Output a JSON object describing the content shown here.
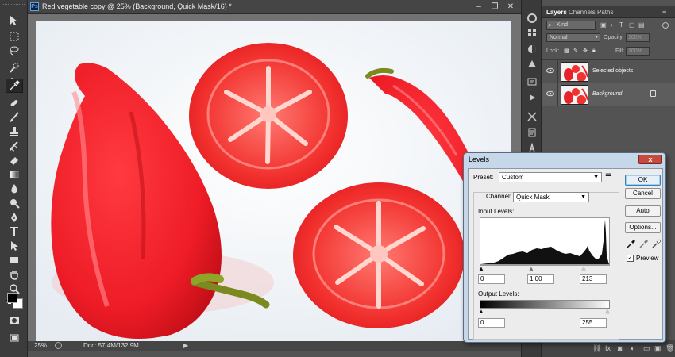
{
  "document": {
    "ps_badge": "Ps",
    "title": "Red vegetable copy @ 25% (Background, Quick Mask/16) *",
    "minimize": "–",
    "restore": "❐",
    "close": "✕",
    "status_zoom": "25%",
    "status_doc": "Doc: 57.4M/132.9M",
    "status_arrow": "▶"
  },
  "tools": [
    "move-tool",
    "marquee-tool",
    "lasso-tool",
    "quick-selection-tool",
    "crop-tool",
    "eyedropper-tool",
    "healing-brush-tool",
    "brush-tool",
    "clone-stamp-tool",
    "history-brush-tool",
    "eraser-tool",
    "gradient-tool",
    "blur-tool",
    "dodge-tool",
    "pen-tool",
    "type-tool",
    "path-selection-tool",
    "shape-tool",
    "hand-tool",
    "zoom-tool",
    "default-colors",
    "foreground-color",
    "background-color",
    "quick-mask-mode",
    "screen-mode"
  ],
  "layers_panel": {
    "tabs": [
      "Layers",
      "Channels",
      "Paths"
    ],
    "filter_kind": "Kind",
    "blend_mode": "Normal",
    "opacity_label": "Opacity:",
    "opacity_value": "100%",
    "lock_label": "Lock:",
    "fill_label": "Fill:",
    "fill_value": "100%",
    "layers": [
      {
        "name": "Selected objects",
        "selected": false
      },
      {
        "name": "Background",
        "selected": true,
        "locked": true
      }
    ]
  },
  "levels_dialog": {
    "title": "Levels",
    "close": "x",
    "preset_label": "Preset:",
    "preset_value": "Custom",
    "channel_label": "Channel:",
    "channel_value": "Quick Mask",
    "input_levels_label": "Input Levels:",
    "input_black": "0",
    "input_gamma": "1.00",
    "input_white": "213",
    "output_levels_label": "Output Levels:",
    "output_black": "0",
    "output_white": "255",
    "buttons": {
      "ok": "OK",
      "cancel": "Cancel",
      "auto": "Auto",
      "options": "Options..."
    },
    "preview_label": "Preview",
    "preview_checked": true
  },
  "colors": {
    "ui_dark": "#535353",
    "dialog_frame": "#c7d7ea",
    "close_red": "#c84a3c",
    "vegetable_red": "#f0242e"
  }
}
